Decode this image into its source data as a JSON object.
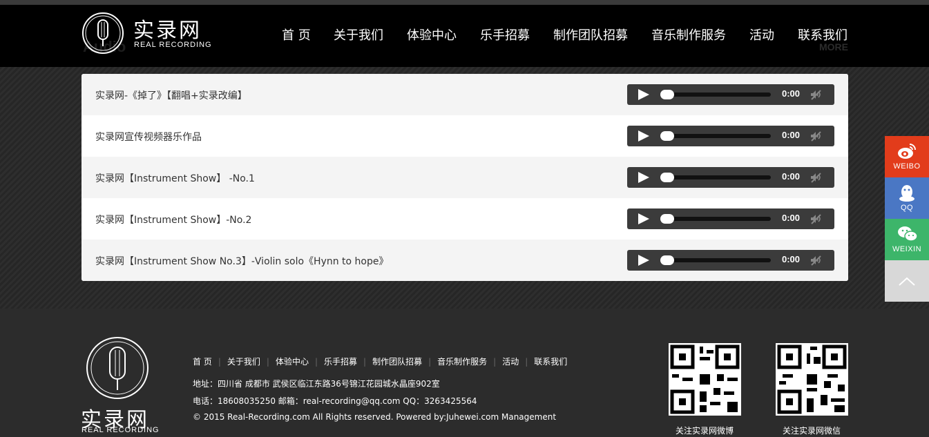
{
  "brand": {
    "cn": "实录网",
    "en": "REAL RECORDING",
    "ghost_audio": "Audio",
    "ghost_more": "MORE"
  },
  "nav": [
    {
      "label": "首 页"
    },
    {
      "label": "关于我们"
    },
    {
      "label": "体验中心"
    },
    {
      "label": "乐手招募"
    },
    {
      "label": "制作团队招募"
    },
    {
      "label": "音乐制作服务"
    },
    {
      "label": "活动"
    },
    {
      "label": "联系我们"
    }
  ],
  "tracks": [
    {
      "title": "实录网-《掉了》【翻唱+实录改编】",
      "time": "0:00"
    },
    {
      "title": "实录网宣传视频器乐作品",
      "time": "0:00"
    },
    {
      "title": "实录网【Instrument Show】 -No.1",
      "time": "0:00"
    },
    {
      "title": "实录网【Instrument Show】-No.2",
      "time": "0:00"
    },
    {
      "title": "实录网【Instrument Show No.3】-Violin solo《Hynn to hope》",
      "time": "0:00"
    }
  ],
  "social": {
    "weibo": {
      "label": "WEIBO",
      "color": "#e23c1b"
    },
    "qq": {
      "label": "QQ",
      "color": "#4a77c4"
    },
    "weixin": {
      "label": "WEIXIN",
      "color": "#3db56a"
    },
    "top": {
      "color": "#d8d8d8"
    }
  },
  "footer": {
    "links": [
      {
        "label": "首 页"
      },
      {
        "label": "关于我们"
      },
      {
        "label": "体验中心"
      },
      {
        "label": "乐手招募"
      },
      {
        "label": "制作团队招募"
      },
      {
        "label": "音乐制作服务"
      },
      {
        "label": "活动"
      },
      {
        "label": "联系我们"
      }
    ],
    "address": "地址：四川省 成都市 武侯区临江东路36号锦江花园城水晶座902室",
    "contact": "电话：18608035250 邮箱：real-recording@qq.com QQ：3263425564",
    "copyright": "© 2015 Real-Recording.com All Rights reserved. Powered by:Juhewei.com Management",
    "qr_weibo_caption": "关注实录网微博",
    "qr_weixin_caption": "关注实录网微信"
  }
}
